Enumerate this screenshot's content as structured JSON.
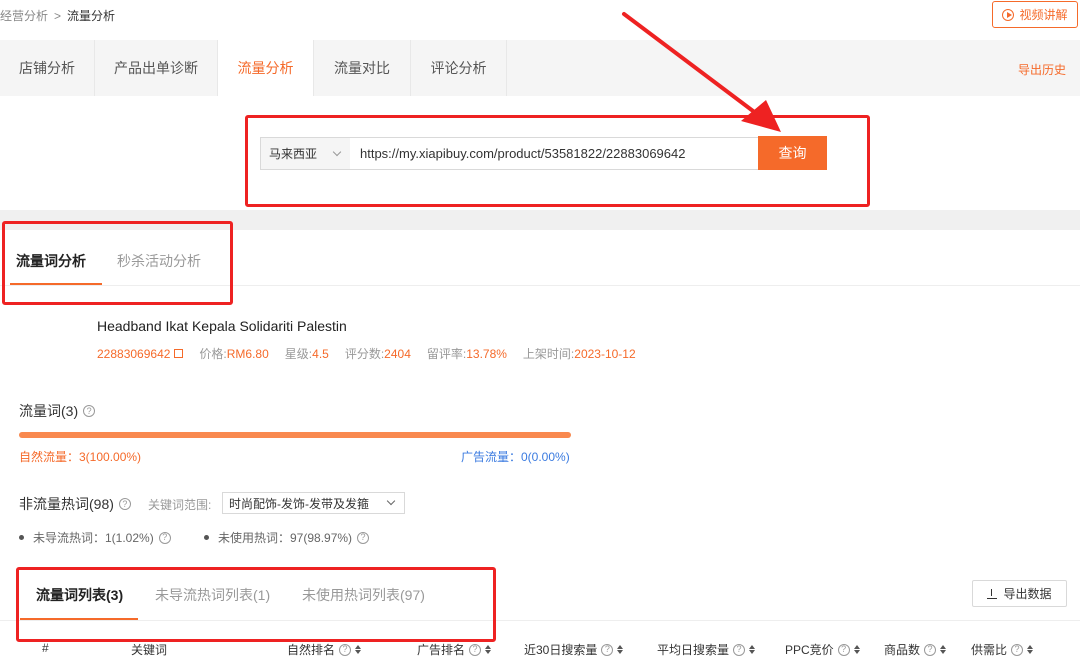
{
  "breadcrumb": {
    "parent": "经营分析",
    "separator": ">",
    "current": "流量分析"
  },
  "video_button": {
    "label": "视频讲解",
    "icon": "play-circle-icon"
  },
  "main_tabs": [
    {
      "label": "店铺分析",
      "active": false
    },
    {
      "label": "产品出单诊断",
      "active": false
    },
    {
      "label": "流量分析",
      "active": true
    },
    {
      "label": "流量对比",
      "active": false
    },
    {
      "label": "评论分析",
      "active": false
    }
  ],
  "export_history": "导出历史",
  "search": {
    "country": "马来西亚",
    "url": "https://my.xiapibuy.com/product/53581822/22883069642",
    "query_label": "查询"
  },
  "sub_tabs": [
    {
      "label": "流量词分析",
      "active": true
    },
    {
      "label": "秒杀活动分析",
      "active": false
    }
  ],
  "product": {
    "title": "Headband Ikat Kepala Solidariti Palestin",
    "id": "22883069642",
    "price_label": "价格:",
    "price": "RM6.80",
    "rating_label": "星级:",
    "rating": "4.5",
    "reviews_label": "评分数:",
    "reviews": "2404",
    "review_rate_label": "留评率:",
    "review_rate": "13.78%",
    "listed_label": "上架时间:",
    "listed": "2023-10-12"
  },
  "traffic_words": {
    "title": "流量词(3)",
    "natural_label": "自然流量：3(100.00%)",
    "ad_label": "广告流量：0(0.00%)",
    "natural_fraction": 1.0
  },
  "non_traffic": {
    "title": "非流量热词(98)",
    "scope_label": "关键词范围:",
    "scope_value": "时尚配饰-发饰-发带及发箍",
    "stat1": "未导流热词：1(1.02%)",
    "stat2": "未使用热词：97(98.97%)"
  },
  "list_tabs": [
    {
      "label": "流量词列表(3)",
      "active": true
    },
    {
      "label": "未导流热词列表(1)",
      "active": false
    },
    {
      "label": "未使用热词列表(97)",
      "active": false
    }
  ],
  "export_data": "导出数据",
  "table_headers": [
    "#",
    "关键词",
    "自然排名",
    "广告排名",
    "近30日搜索量",
    "平均日搜索量",
    "PPC竞价",
    "商品数",
    "供需比"
  ],
  "colors": {
    "accent": "#f56a2a",
    "annotation": "#ee2222",
    "ad_blue": "#3b7be0"
  }
}
